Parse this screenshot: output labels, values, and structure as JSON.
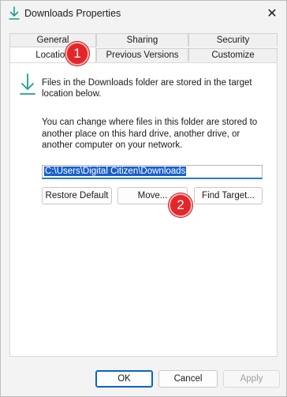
{
  "window": {
    "title": "Downloads Properties"
  },
  "tabs": {
    "row1": [
      "General",
      "Sharing",
      "Security"
    ],
    "row2": [
      "Location",
      "Previous Versions",
      "Customize"
    ],
    "active": "Location"
  },
  "location": {
    "info": "Files in the Downloads folder are stored in the target location below.",
    "description": "You can change where files in this folder are stored to another place on this hard drive, another drive, or another computer on your network.",
    "path": "C:\\Users\\Digital Citizen\\Downloads",
    "restore_default_label": "Restore Default",
    "move_label": "Move...",
    "find_target_label": "Find Target..."
  },
  "footer": {
    "ok_label": "OK",
    "cancel_label": "Cancel",
    "apply_label": "Apply"
  },
  "markers": [
    "1",
    "2"
  ],
  "colors": {
    "accent": "#0a62c5",
    "marker": "#e3262a",
    "icon": "#1a9e8f"
  },
  "icons": {
    "title": "download-arrow-icon",
    "location": "download-arrow-icon",
    "close": "close-icon"
  }
}
